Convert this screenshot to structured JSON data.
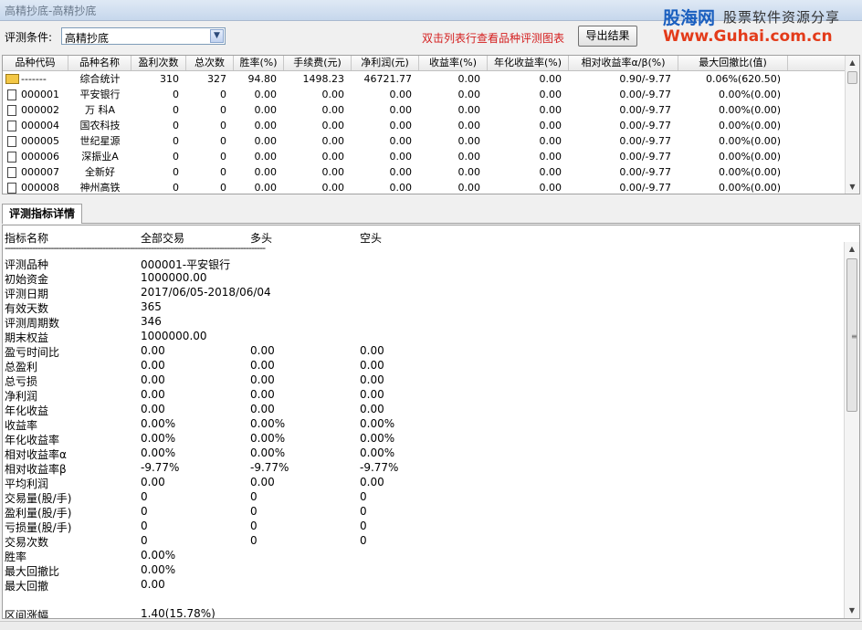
{
  "window": {
    "title": "高精抄底-高精抄底"
  },
  "brand": {
    "logo": "股海网",
    "slogan": "股票软件资源分享",
    "url": "Www.Guhai.com.cn"
  },
  "toolbar": {
    "condition_label": "评测条件:",
    "condition_value": "高精抄底",
    "hint": "双击列表行查看品种评测图表",
    "export_label": "导出结果"
  },
  "table": {
    "columns": [
      "品种代码",
      "品种名称",
      "盈利次数",
      "总次数",
      "胜率(%)",
      "手续费(元)",
      "净利润(元)",
      "收益率(%)",
      "年化收益率(%)",
      "相对收益率α/β(%)",
      "最大回撤比(值)"
    ],
    "rows": [
      [
        "-------",
        "综合统计",
        "310",
        "327",
        "94.80",
        "1498.23",
        "46721.77",
        "0.00",
        "0.00",
        "0.90/-9.77",
        "0.06%(620.50)"
      ],
      [
        "000001",
        "平安银行",
        "0",
        "0",
        "0.00",
        "0.00",
        "0.00",
        "0.00",
        "0.00",
        "0.00/-9.77",
        "0.00%(0.00)"
      ],
      [
        "000002",
        "万 科A",
        "0",
        "0",
        "0.00",
        "0.00",
        "0.00",
        "0.00",
        "0.00",
        "0.00/-9.77",
        "0.00%(0.00)"
      ],
      [
        "000004",
        "国农科技",
        "0",
        "0",
        "0.00",
        "0.00",
        "0.00",
        "0.00",
        "0.00",
        "0.00/-9.77",
        "0.00%(0.00)"
      ],
      [
        "000005",
        "世纪星源",
        "0",
        "0",
        "0.00",
        "0.00",
        "0.00",
        "0.00",
        "0.00",
        "0.00/-9.77",
        "0.00%(0.00)"
      ],
      [
        "000006",
        "深振业A",
        "0",
        "0",
        "0.00",
        "0.00",
        "0.00",
        "0.00",
        "0.00",
        "0.00/-9.77",
        "0.00%(0.00)"
      ],
      [
        "000007",
        "全新好",
        "0",
        "0",
        "0.00",
        "0.00",
        "0.00",
        "0.00",
        "0.00",
        "0.00/-9.77",
        "0.00%(0.00)"
      ],
      [
        "000008",
        "神州高铁",
        "0",
        "0",
        "0.00",
        "0.00",
        "0.00",
        "0.00",
        "0.00",
        "0.00/-9.77",
        "0.00%(0.00)"
      ]
    ]
  },
  "detail": {
    "tab_label": "评测指标详情",
    "headers": [
      "指标名称",
      "全部交易",
      "多头",
      "空头"
    ],
    "separator": "------------------------------------------------------------------------------------------------",
    "rows": [
      [
        "评测品种",
        "000001-平安银行",
        "",
        ""
      ],
      [
        "初始资金",
        "1000000.00",
        "",
        ""
      ],
      [
        "评测日期",
        "2017/06/05-2018/06/04",
        "",
        ""
      ],
      [
        "有效天数",
        "365",
        "",
        ""
      ],
      [
        "评测周期数",
        "346",
        "",
        ""
      ],
      [
        "期末权益",
        "1000000.00",
        "",
        ""
      ],
      [
        "盈亏时间比",
        "0.00",
        "0.00",
        "0.00"
      ],
      [
        "总盈利",
        "0.00",
        "0.00",
        "0.00"
      ],
      [
        "总亏损",
        "0.00",
        "0.00",
        "0.00"
      ],
      [
        "净利润",
        "0.00",
        "0.00",
        "0.00"
      ],
      [
        "年化收益",
        "0.00",
        "0.00",
        "0.00"
      ],
      [
        "收益率",
        "0.00%",
        "0.00%",
        "0.00%"
      ],
      [
        "年化收益率",
        "0.00%",
        "0.00%",
        "0.00%"
      ],
      [
        "相对收益率α",
        "0.00%",
        "0.00%",
        "0.00%"
      ],
      [
        "相对收益率β",
        "-9.77%",
        "-9.77%",
        "-9.77%"
      ],
      [
        "平均利润",
        "0.00",
        "0.00",
        "0.00"
      ],
      [
        "交易量(股/手)",
        "0",
        "0",
        "0"
      ],
      [
        "盈利量(股/手)",
        "0",
        "0",
        "0"
      ],
      [
        "亏损量(股/手)",
        "0",
        "0",
        "0"
      ],
      [
        "交易次数",
        "0",
        "0",
        "0"
      ],
      [
        "胜率",
        "0.00%",
        "",
        ""
      ],
      [
        "最大回撤比",
        "0.00%",
        "",
        ""
      ],
      [
        "最大回撤",
        "0.00",
        "",
        ""
      ],
      [
        "",
        "",
        "",
        ""
      ],
      [
        "区间涨幅",
        "1.40(15.78%)",
        "",
        ""
      ]
    ]
  },
  "colors": {
    "hint": "#d42020",
    "brand_blue": "#1a5fbf",
    "brand_red": "#e33b1a",
    "summary_icon": "#f3c745"
  },
  "icons": {
    "dropdown": "chevron-down-icon",
    "row": "document-icon",
    "summary": "summary-icon"
  }
}
